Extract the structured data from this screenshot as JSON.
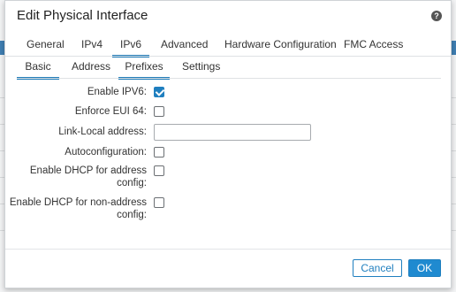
{
  "dialog": {
    "title": "Edit Physical Interface"
  },
  "tabs": [
    "General",
    "IPv4",
    "IPv6",
    "Advanced",
    "Hardware Configuration",
    "FMC Access"
  ],
  "active_tab": "IPv6",
  "subtabs": [
    "Basic",
    "Address",
    "Prefixes",
    "Settings"
  ],
  "active_subtabs": [
    "Basic",
    "Prefixes"
  ],
  "form": {
    "enable_ipv6": {
      "label": "Enable IPV6:",
      "checked": true
    },
    "enforce_eui64": {
      "label": "Enforce EUI 64:",
      "checked": false
    },
    "link_local": {
      "label": "Link-Local address:",
      "value": ""
    },
    "autoconfiguration": {
      "label": "Autoconfiguration:",
      "checked": false
    },
    "dhcp_address": {
      "label_line1": "Enable DHCP for address",
      "label_line2": "config:",
      "checked": false
    },
    "dhcp_non_address": {
      "label_line1": "Enable DHCP for non-address",
      "label_line2": "config:",
      "checked": false
    }
  },
  "buttons": {
    "cancel": "Cancel",
    "ok": "OK"
  },
  "colors": {
    "accent": "#1f7fbf",
    "header_band": "#3f7fb3"
  }
}
